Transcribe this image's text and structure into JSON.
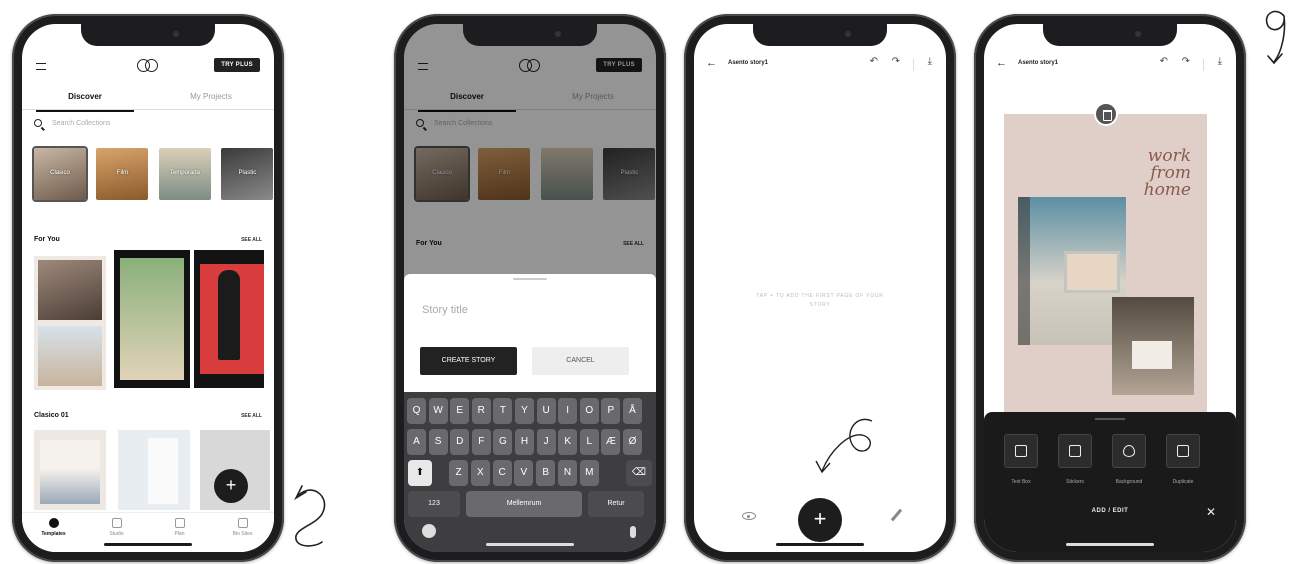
{
  "phone1": {
    "try_plus": "TRY PLUS",
    "tabs": [
      "Discover",
      "My Projects"
    ],
    "search_placeholder": "Search Collections",
    "collections": [
      "Clasico",
      "Film",
      "Temporada",
      "Plastic"
    ],
    "for_you": "For You",
    "see_all": "SEE ALL",
    "clasico_01": "Clasico 01",
    "nav": [
      "Templates",
      "Studio",
      "Plan",
      "Bio Sites"
    ],
    "fab": "+"
  },
  "phone2": {
    "try_plus": "TRY PLUS",
    "tabs": [
      "Discover",
      "My Projects"
    ],
    "search_placeholder": "Search Collections",
    "collections": [
      "Clasico",
      "Film",
      "",
      "Plastic"
    ],
    "for_you": "For You",
    "see_all": "SEE ALL",
    "story_title_placeholder": "Story title",
    "create_story": "CREATE STORY",
    "cancel": "CANCEL",
    "keyboard": {
      "row1": [
        "Q",
        "W",
        "E",
        "R",
        "T",
        "Y",
        "U",
        "I",
        "O",
        "P",
        "Å"
      ],
      "row2": [
        "A",
        "S",
        "D",
        "F",
        "G",
        "H",
        "J",
        "K",
        "L",
        "Æ",
        "Ø"
      ],
      "row3": [
        "Z",
        "X",
        "C",
        "V",
        "B",
        "N",
        "M"
      ],
      "numbers": "123",
      "space": "Mellemrum",
      "return": "Retur"
    }
  },
  "phone3": {
    "title": "Asento story1",
    "hint": "TAP + TO ADD THE FIRST PAGE OF YOUR STORY",
    "fab": "+"
  },
  "phone4": {
    "title": "Asento story1",
    "script_text": [
      "work",
      "from",
      "home"
    ],
    "tools": [
      "Text Box",
      "Stickers",
      "Background",
      "Duplicate"
    ],
    "add_edit": "ADD / EDIT",
    "close": "✕"
  },
  "annotations": [
    "2",
    "6",
    "9"
  ]
}
